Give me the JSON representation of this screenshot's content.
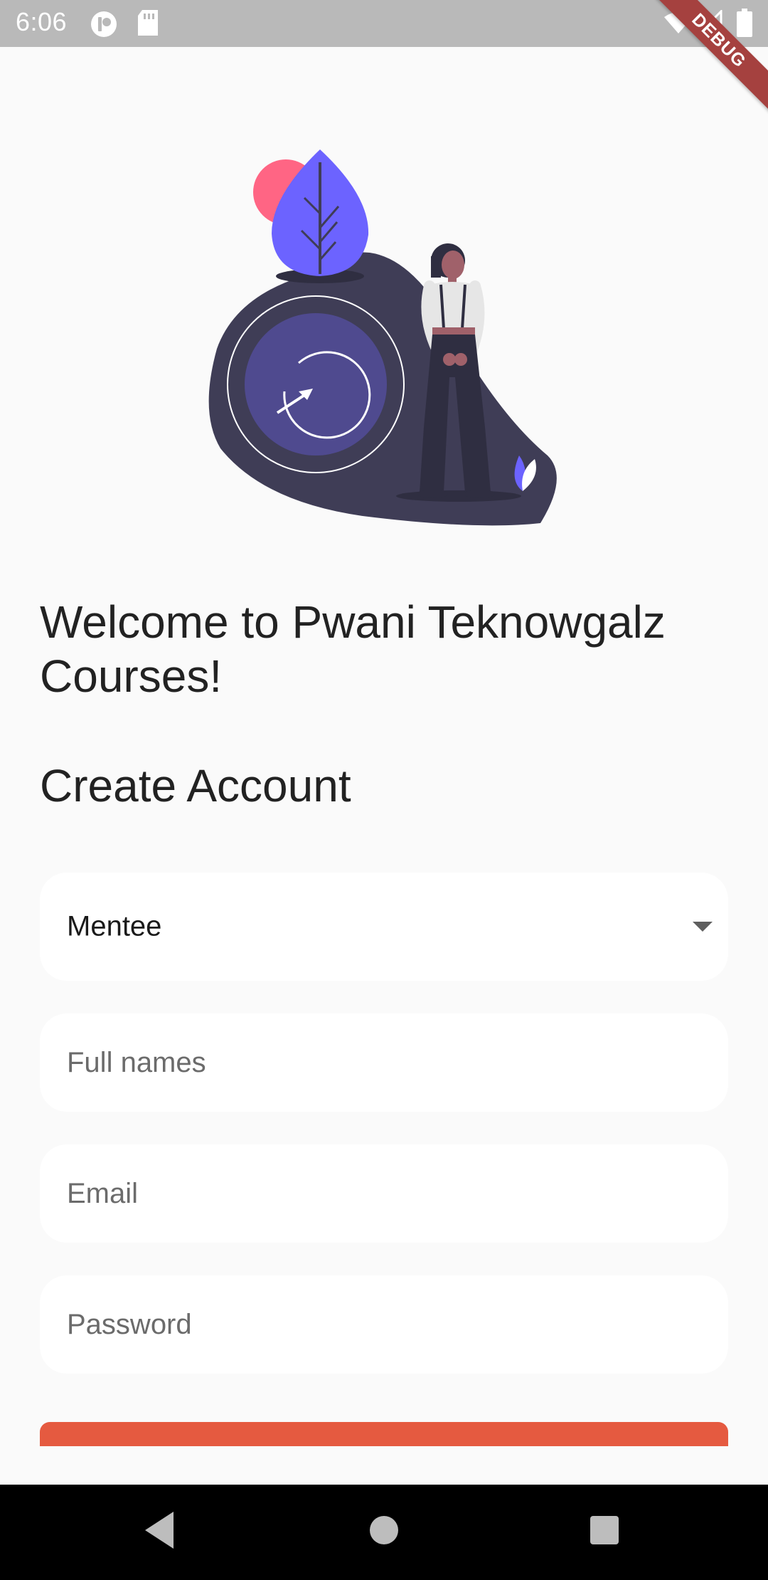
{
  "status_bar": {
    "time": "6:06",
    "icons": [
      "notification-icon",
      "sd-card-icon",
      "wifi-icon",
      "signal-icon",
      "battery-icon"
    ]
  },
  "debug_banner": "DEBUG",
  "welcome_title": "Welcome to Pwani Teknowgalz Courses!",
  "section_title": "Create Account",
  "form": {
    "role_dropdown": {
      "selected": "Mentee"
    },
    "full_names": {
      "placeholder": "Full names",
      "value": ""
    },
    "email": {
      "placeholder": "Email",
      "value": ""
    },
    "password": {
      "placeholder": "Password",
      "value": ""
    }
  },
  "nav_bar": {
    "buttons": [
      "back-icon",
      "home-icon",
      "recents-icon"
    ]
  },
  "colors": {
    "accent": "#6c63ff",
    "submit_button": "#e55a40",
    "status_bar": "#b9b9b9",
    "background": "#fafafa"
  }
}
